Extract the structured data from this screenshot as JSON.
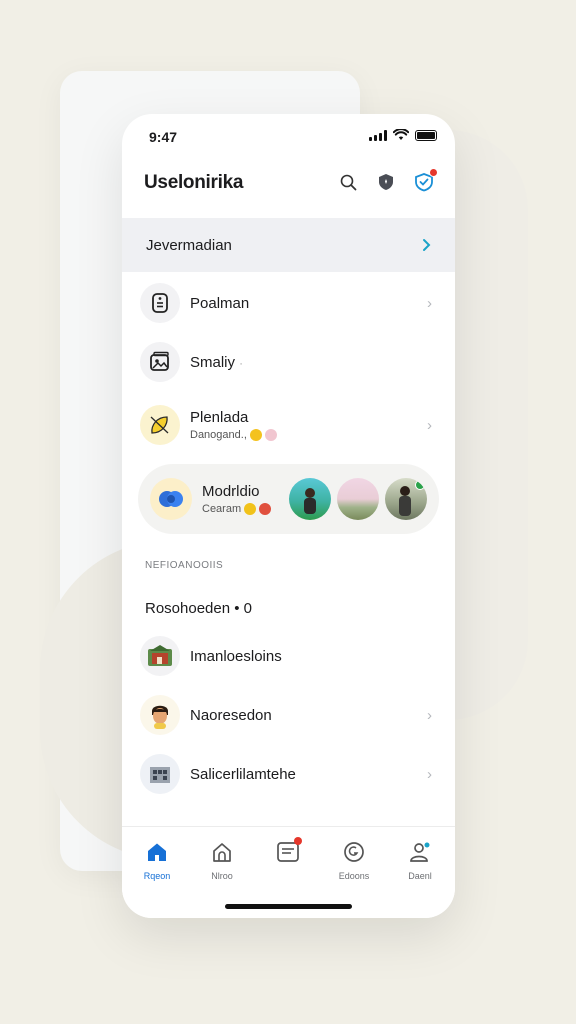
{
  "status_bar": {
    "time": "9:47"
  },
  "header": {
    "title": "Uselonirika",
    "icons": [
      "search-icon",
      "shield-icon",
      "heart-shield-icon"
    ]
  },
  "banner": {
    "label": "Jevermadian"
  },
  "list": [
    {
      "title": "Poalman",
      "icon": "receipt-icon"
    },
    {
      "title": "Smaliy",
      "icon": "photo-stack-icon",
      "dot": "·"
    },
    {
      "title": "Plenlada",
      "subtitle": "Danogand.,",
      "icon": "lemon-icon"
    }
  ],
  "pill_card": {
    "title": "Modrldio",
    "subtitle": "Cearam",
    "icon": "blue-orbs-icon",
    "thumbnails": [
      "person-green-thumb",
      "landscape-thumb",
      "person-dark-thumb"
    ]
  },
  "section": {
    "caption": "NEFIOANOOIIS",
    "heading": "Rosohoeden • 0"
  },
  "section_list": [
    {
      "title": "Imanloesloins",
      "icon": "house-thumb"
    },
    {
      "title": "Naoresedon",
      "icon": "face-thumb"
    },
    {
      "title": "Salicerlilamtehe",
      "icon": "building-thumb"
    }
  ],
  "tabbar": {
    "tabs": [
      {
        "label": "Rqeon",
        "icon": "home-icon",
        "active": true
      },
      {
        "label": "Nlroo",
        "icon": "house-outline-icon"
      },
      {
        "label": "",
        "icon": "inbox-icon",
        "badge": true
      },
      {
        "label": "Edoons",
        "icon": "compass-icon"
      },
      {
        "label": "Daenl",
        "icon": "person-icon"
      }
    ]
  },
  "colors": {
    "accent": "#1670d6",
    "badge": "#e5372b",
    "banner_bg": "#eff0f3",
    "page_bg": "#f1efe6"
  }
}
